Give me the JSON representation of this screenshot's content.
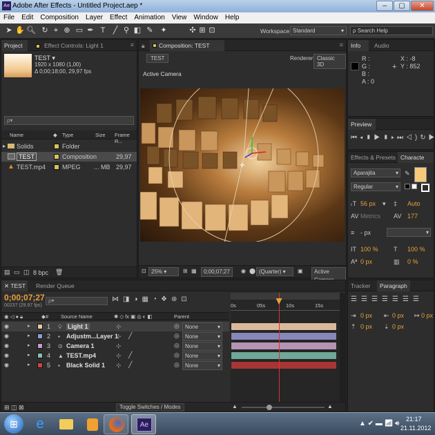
{
  "window": {
    "title": "Adobe After Effects - Untitled Project.aep *",
    "app_icon": "Ae"
  },
  "menu": [
    "File",
    "Edit",
    "Composition",
    "Layer",
    "Effect",
    "Animation",
    "View",
    "Window",
    "Help"
  ],
  "workspace": {
    "label": "Workspace:",
    "value": "Standard",
    "search_placeholder": "Search Help"
  },
  "project": {
    "tab": "Project",
    "effect_controls_tab": "Effect Controls: Light 1",
    "comp_name": "TEST ▾",
    "comp_res": "1920 x 1080 (1,00)",
    "comp_dur": "Δ 0;00;18;00, 29,97 fps",
    "search_placeholder": "ρ▾",
    "columns": [
      "Name",
      "Type",
      "Size",
      "Frame R..."
    ],
    "items": [
      {
        "name": "Solids",
        "type": "Folder",
        "size": "",
        "fr": "",
        "color": "#d8c25b",
        "icon": "folder-icon"
      },
      {
        "name": "TEST",
        "type": "Composition",
        "size": "",
        "fr": "29,97",
        "color": "#d8c25b",
        "icon": "composition-icon"
      },
      {
        "name": "TEST.mp4",
        "type": "MPEG",
        "size": "... MB",
        "fr": "29,97",
        "color": "#d8c25b",
        "icon": "video-file-icon"
      }
    ],
    "bpc": "8 bpc"
  },
  "composition": {
    "tab": "Composition: TEST",
    "subtab": "TEST",
    "renderer_label": "Renderer:",
    "renderer": "Classic 3D",
    "view_label": "Active Camera",
    "zoom": "25%",
    "timecode": "0;00;07;27",
    "resolution": "(Quarter)",
    "camera_view": "Active Camera"
  },
  "info": {
    "tab": "Info",
    "audio_tab": "Audio",
    "R": "R :",
    "G": "G :",
    "B": "B :",
    "A": "A : 0",
    "X": "X : -8",
    "Y": "Y : 852"
  },
  "preview": {
    "tab": "Preview"
  },
  "effects": {
    "tab": "Effects & Presets",
    "char_tab": "Characte"
  },
  "character": {
    "font": "Aparajita",
    "style": "Regular",
    "size": "56 px",
    "leading": "Auto",
    "kerning": "Metrics",
    "tracking": "177",
    "stroke": "- px",
    "vscale": "100 %",
    "hscale": "100 %",
    "baseline": "0 px",
    "tsume": "0 %",
    "swatch_color": "#f6c97a"
  },
  "paragraph": {
    "tracker_tab": "Tracker",
    "tab": "Paragraph",
    "values": [
      "0 px",
      "0 px",
      "0 px",
      "0 px",
      "0 px"
    ]
  },
  "timeline": {
    "tab": "TEST",
    "render_tab": "Render Queue",
    "timecode": "0;00;07;27",
    "frame_info": "00237 (29.97 fps)",
    "search_placeholder": "ρ▾",
    "col_source": "Source Name",
    "col_parent": "Parent",
    "ruler": [
      "0s",
      "05s",
      "10s",
      "15s"
    ],
    "time_fraction": 0.44,
    "layers": [
      {
        "num": "1",
        "name": "Light 1",
        "label": "#e8c89a",
        "parent": "None",
        "bar": "#d9b99a",
        "icon": "light-icon",
        "selected": true
      },
      {
        "num": "2",
        "name": "Adjustm...Layer 1",
        "label": "#9a9ad0",
        "parent": "None",
        "bar": "#8787b8",
        "icon": "adjustment-layer-icon",
        "selected": false
      },
      {
        "num": "3",
        "name": "Camera 1",
        "label": "#c89ac8",
        "parent": "None",
        "bar": "#b493b4",
        "icon": "camera-icon",
        "selected": false
      },
      {
        "num": "4",
        "name": "TEST.mp4",
        "label": "#8abfb0",
        "parent": "None",
        "bar": "#6fa798",
        "icon": "video-file-icon",
        "selected": false
      },
      {
        "num": "5",
        "name": "Black Solid 1",
        "label": "#c44",
        "parent": "None",
        "bar": "#a83535",
        "icon": "solid-icon",
        "selected": false
      }
    ],
    "toggle_label": "Toggle Switches / Modes"
  },
  "taskbar": {
    "time": "21:17",
    "date": "21.11.2012"
  }
}
